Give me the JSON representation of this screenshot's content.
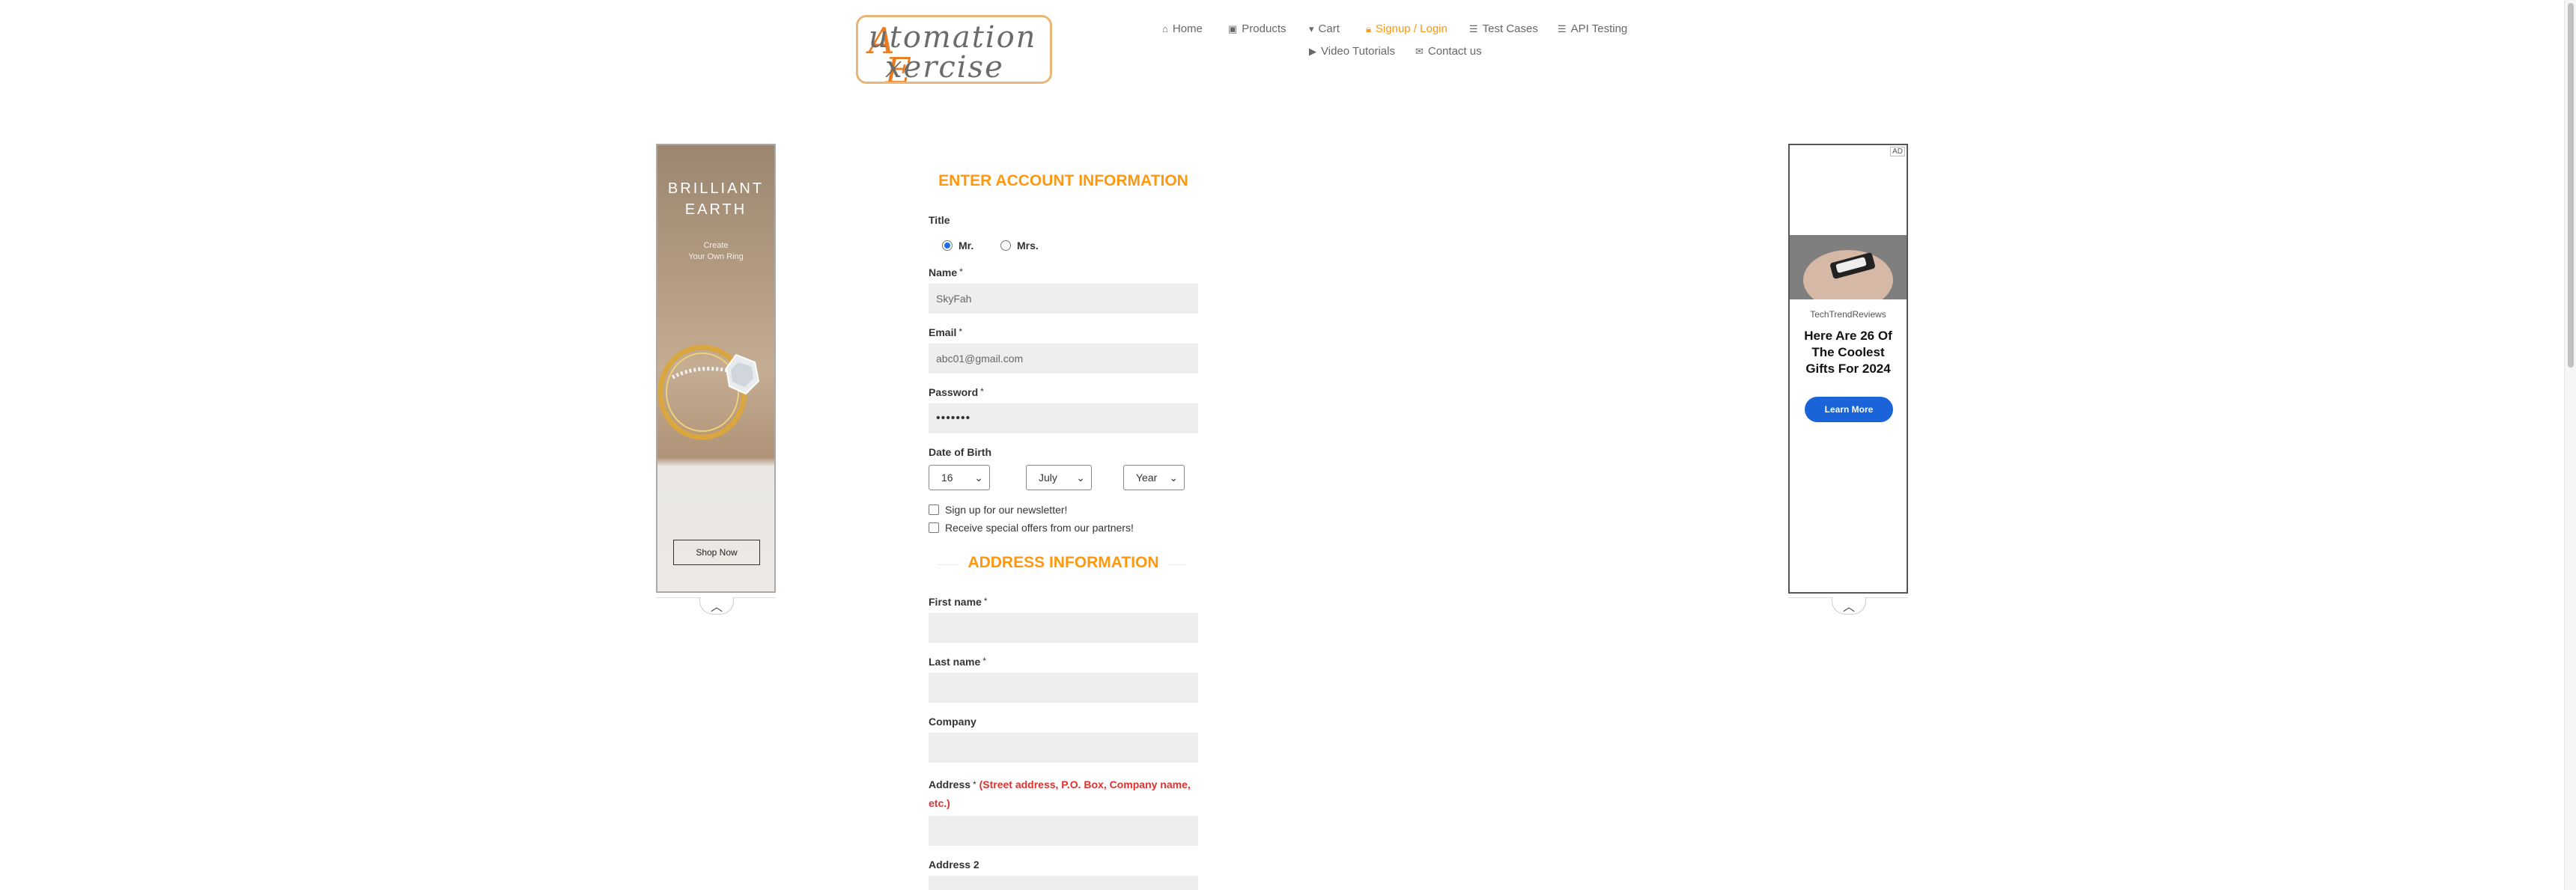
{
  "logo": {
    "line1": "Automation",
    "line2": "Exercise"
  },
  "nav": [
    {
      "label": "Home",
      "icon": "home-icon",
      "glyph": "⌂"
    },
    {
      "label": "Products",
      "icon": "products-icon",
      "glyph": "▣"
    },
    {
      "label": "Cart",
      "icon": "cart-icon",
      "glyph": "🛒"
    },
    {
      "label": "Signup / Login",
      "icon": "lock-icon",
      "glyph": "🔒",
      "active": true
    },
    {
      "label": "Test Cases",
      "icon": "list-icon",
      "glyph": "☰"
    },
    {
      "label": "API Testing",
      "icon": "list-icon",
      "glyph": "☰"
    },
    {
      "label": "Video Tutorials",
      "icon": "youtube-icon",
      "glyph": "▶"
    },
    {
      "label": "Contact us",
      "icon": "envelope-icon",
      "glyph": "✉"
    }
  ],
  "ad_left": {
    "brand": "BRILLIANT\nEARTH",
    "tagline": "Create\nYour Own Ring",
    "cta": "Shop Now"
  },
  "ad_right": {
    "tag": "AD",
    "site": "TechTrendReviews",
    "headline": "Here Are 26 Of The Coolest Gifts For 2024",
    "cta": "Learn More"
  },
  "form": {
    "account_title": "ENTER ACCOUNT INFORMATION",
    "title_label": "Title",
    "title_options": [
      "Mr.",
      "Mrs."
    ],
    "title_selected": "Mr.",
    "name_label": "Name",
    "name_value": "SkyFah",
    "email_label": "Email",
    "email_value": "abc01@gmail.com",
    "password_label": "Password",
    "password_value": "•••••••",
    "dob_label": "Date of Birth",
    "dob_day": "16",
    "dob_month": "July",
    "dob_year": "Year",
    "newsletter_label": "Sign up for our newsletter!",
    "offers_label": "Receive special offers from our partners!",
    "address_title": "ADDRESS INFORMATION",
    "first_name_label": "First name",
    "last_name_label": "Last name",
    "company_label": "Company",
    "address_label": "Address",
    "address_hint": "(Street address, P.O. Box, Company name,",
    "address_hint2": "etc.)",
    "address2_label": "Address 2",
    "required_mark": "*"
  },
  "colors": {
    "accent": "#fe980f",
    "field_bg": "#eeeeee",
    "hint": "#e2312f",
    "text": "#333333"
  }
}
